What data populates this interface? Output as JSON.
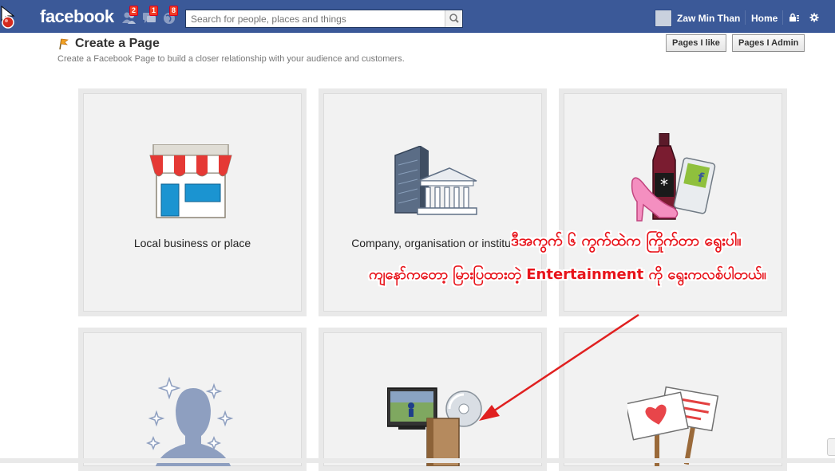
{
  "topbar": {
    "logo": "facebook",
    "notifications": {
      "friend_requests": "2",
      "messages": "1",
      "notifications": "8"
    },
    "search_placeholder": "Search for people, places and things",
    "user_name": "Zaw Min Than",
    "home_label": "Home",
    "icons": [
      "friend-requests-icon",
      "messages-icon",
      "notifications-globe-icon",
      "search-icon",
      "privacy-icon",
      "gear-icon"
    ]
  },
  "header": {
    "title": "Create a Page",
    "subtitle": "Create a Facebook Page to build a closer relationship with your audience and customers.",
    "pages_i_like": "Pages I like",
    "pages_i_admin": "Pages I Admin"
  },
  "categories": [
    {
      "label": "Local business or place",
      "icon": "storefront-icon"
    },
    {
      "label": "Company, organisation or institut",
      "icon": "buildings-icon"
    },
    {
      "label": "",
      "icon": "brand-product-icon"
    },
    {
      "label": "",
      "icon": "person-silhouette-icon"
    },
    {
      "label": "",
      "icon": "entertainment-icon"
    },
    {
      "label": "",
      "icon": "cause-signs-icon"
    }
  ],
  "annotations": {
    "line1": "ဒီအကွက် ၆ ကွက်ထဲက ကြိုက်တာ ရွေးပါ။",
    "line2": "ကျနော်ကတော့ မြားပြထားတဲ့ Entertainment ကို ရွေးကလစ်ပါတယ်။"
  },
  "colors": {
    "fb_blue": "#3b5998",
    "annotation_red": "#e8141b",
    "badge_red": "#f03d25"
  }
}
